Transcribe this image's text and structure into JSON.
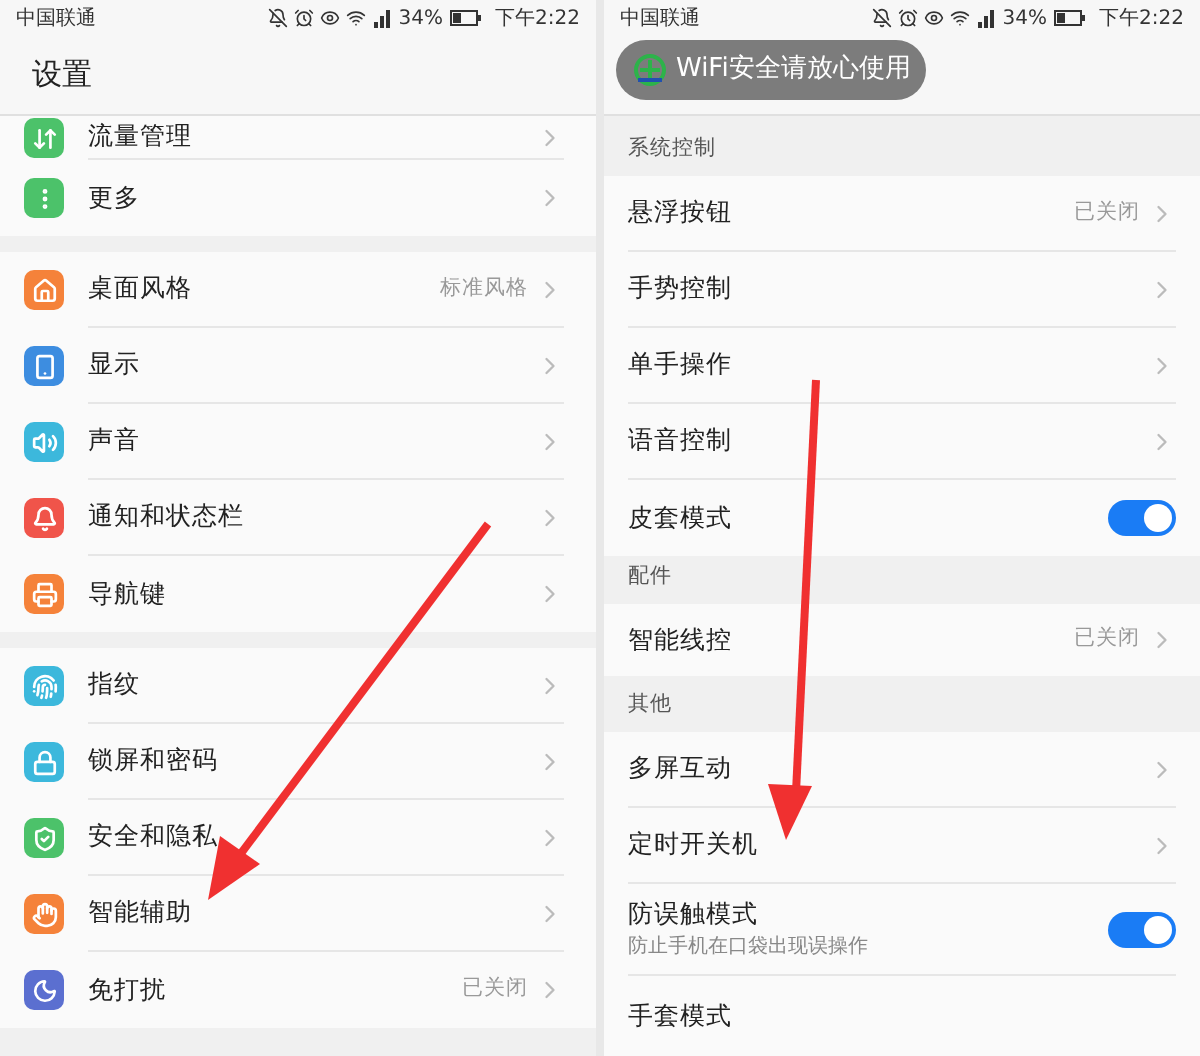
{
  "left": {
    "status_bar": {
      "carrier": "中国联通",
      "battery": "34%",
      "time": "下午2:22"
    },
    "title": "设置",
    "groups": [
      [
        {
          "label": "流量管理",
          "color": "#4cc26a"
        },
        {
          "label": "更多",
          "color": "#4cc26a"
        }
      ],
      [
        {
          "label": "桌面风格",
          "value": "标准风格",
          "color": "#f5823a"
        },
        {
          "label": "显示",
          "color": "#3d8de0"
        },
        {
          "label": "声音",
          "color": "#3cb8dc"
        },
        {
          "label": "通知和状态栏",
          "color": "#f0544a"
        },
        {
          "label": "导航键",
          "color": "#f5823a"
        }
      ],
      [
        {
          "label": "指纹",
          "color": "#3cb8dc"
        },
        {
          "label": "锁屏和密码",
          "color": "#3cb8dc"
        },
        {
          "label": "安全和隐私",
          "color": "#4cc26a"
        },
        {
          "label": "智能辅助",
          "color": "#f5823a"
        },
        {
          "label": "免打扰",
          "value": "已关闭",
          "color": "#5b6fd0"
        }
      ]
    ]
  },
  "right": {
    "status_bar": {
      "carrier": "中国联通",
      "battery": "34%",
      "time": "下午2:22"
    },
    "toast": {
      "text": "WiFi安全请放心使用"
    },
    "items": [
      {
        "kind": "section",
        "label": "系统控制"
      },
      {
        "kind": "link",
        "label": "悬浮按钮",
        "value": "已关闭"
      },
      {
        "kind": "link",
        "label": "手势控制"
      },
      {
        "kind": "link",
        "label": "单手操作"
      },
      {
        "kind": "link",
        "label": "语音控制"
      },
      {
        "kind": "toggle",
        "label": "皮套模式",
        "on": true
      },
      {
        "kind": "section",
        "label": "配件"
      },
      {
        "kind": "link",
        "label": "智能线控",
        "value": "已关闭"
      },
      {
        "kind": "section",
        "label": "其他"
      },
      {
        "kind": "link",
        "label": "多屏互动"
      },
      {
        "kind": "link",
        "label": "定时开关机"
      },
      {
        "kind": "toggle",
        "label": "防误触模式",
        "subtitle": "防止手机在口袋出现误操作",
        "on": true
      },
      {
        "kind": "plain",
        "label": "手套模式"
      }
    ]
  }
}
